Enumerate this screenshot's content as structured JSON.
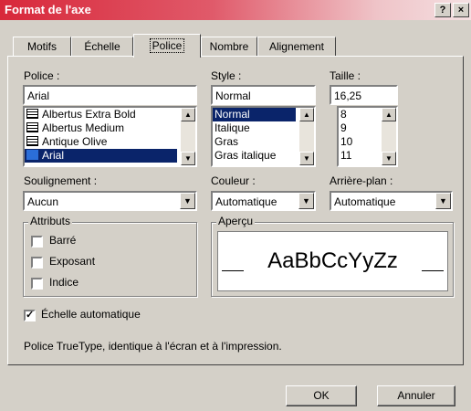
{
  "window": {
    "title": "Format de l'axe",
    "help_label": "?",
    "close_label": "×"
  },
  "tabs": [
    {
      "label": "Motifs",
      "active": false
    },
    {
      "label": "Échelle",
      "active": false
    },
    {
      "label": "Police",
      "active": true
    },
    {
      "label": "Nombre",
      "active": false
    },
    {
      "label": "Alignement",
      "active": false
    }
  ],
  "font": {
    "label": "Police :",
    "value": "Arial",
    "items": [
      {
        "label": "Albertus Extra Bold",
        "icon": "printer-font-icon",
        "selected": false
      },
      {
        "label": "Albertus Medium",
        "icon": "printer-font-icon",
        "selected": false
      },
      {
        "label": "Antique Olive",
        "icon": "printer-font-icon",
        "selected": false
      },
      {
        "label": "Arial",
        "icon": "truetype-font-icon",
        "selected": true
      }
    ]
  },
  "style": {
    "label": "Style :",
    "value": "Normal",
    "items": [
      {
        "label": "Normal",
        "selected": true
      },
      {
        "label": "Italique",
        "selected": false
      },
      {
        "label": "Gras",
        "selected": false
      },
      {
        "label": "Gras italique",
        "selected": false
      }
    ]
  },
  "size": {
    "label": "Taille :",
    "value": "16,25",
    "items": [
      {
        "label": "8",
        "selected": false
      },
      {
        "label": "9",
        "selected": false
      },
      {
        "label": "10",
        "selected": false
      },
      {
        "label": "11",
        "selected": false
      }
    ]
  },
  "underline": {
    "label": "Soulignement :",
    "value": "Aucun"
  },
  "color": {
    "label": "Couleur :",
    "value": "Automatique"
  },
  "background": {
    "label": "Arrière-plan :",
    "value": "Automatique"
  },
  "attributes": {
    "title": "Attributs",
    "items": [
      {
        "label": "Barré",
        "checked": false
      },
      {
        "label": "Exposant",
        "checked": false
      },
      {
        "label": "Indice",
        "checked": false
      }
    ]
  },
  "preview": {
    "title": "Aperçu",
    "sample": "AaBbCcYyZz"
  },
  "auto_scale": {
    "label": "Échelle automatique",
    "checked": true
  },
  "info_text": "Police TrueType, identique à l'écran et à l'impression.",
  "buttons": {
    "ok": "OK",
    "cancel": "Annuler"
  }
}
